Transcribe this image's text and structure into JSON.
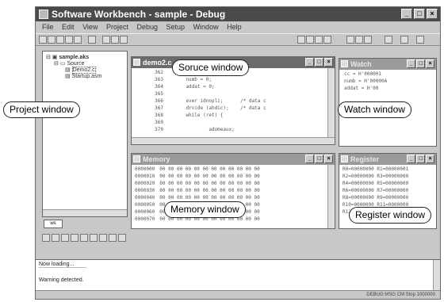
{
  "app": {
    "title": "Software Workbench - sample - Debug"
  },
  "menu": [
    "File",
    "Edit",
    "View",
    "Project",
    "Debug",
    "Setup",
    "Window",
    "Help"
  ],
  "project_window": {
    "root": "sample.aks",
    "folder": "Source",
    "files": [
      "Demo2.c",
      "Startup.asm"
    ],
    "tab": "ws"
  },
  "source_window": {
    "title": "demo2.c",
    "lines": [
      {
        "num": "362",
        "code": "{"
      },
      {
        "num": "363",
        "code": "    numb = 0;"
      },
      {
        "num": "364",
        "code": "    addat = 0;"
      },
      {
        "num": "365",
        "code": ""
      },
      {
        "num": "366",
        "code": "    ever idnopli;      /* data c"
      },
      {
        "num": "367",
        "code": "    drvide (ahdic);    /* data c"
      },
      {
        "num": "368",
        "code": "    while (ret) {"
      },
      {
        "num": "369",
        "code": ""
      },
      {
        "num": "370",
        "code": "            adomeaux;"
      }
    ]
  },
  "watch_window": {
    "title": "Watch",
    "items": [
      "cc = H'000001",
      "numb = H'00000A",
      "addat = H'00"
    ]
  },
  "memory_window": {
    "title": "Memory",
    "rows": [
      {
        "addr": "0000000",
        "hex": "00 00 00 00 00 00 00 00 00 00 00 00"
      },
      {
        "addr": "0000010",
        "hex": "00 00 00 00 00 00 00 00 00 00 00 00"
      },
      {
        "addr": "0000020",
        "hex": "00 00 00 00 00 00 00 00 00 00 00 00"
      },
      {
        "addr": "0000030",
        "hex": "00 00 00 00 00 00 00 00 00 00 00 00"
      },
      {
        "addr": "0000040",
        "hex": "00 00 00 00 00 00 00 00 00 00 00 00"
      },
      {
        "addr": "0000050",
        "hex": "00 00 00 00 00 00 00 00 00 00 00 00"
      },
      {
        "addr": "0000060",
        "hex": "00 00 00 00 00 00 00 00 00 00 00 00"
      },
      {
        "addr": "0000070",
        "hex": "00 00 00 00 00 00 00 00 00 00 00 00"
      }
    ]
  },
  "register_window": {
    "title": "Register",
    "rows": [
      "R0=00000000  R1=00000001",
      "R2=00000000  R3=00000000",
      "R4=00000000  R5=00000000",
      "R6=00000000  R7=00000000",
      "R8=00000000  R9=00000000",
      "R10=0000000  R11=0000000",
      "R12=0000000  R13=0000000"
    ]
  },
  "output_window": {
    "lines": [
      "Now loading...",
      "Warning detected."
    ]
  },
  "status": {
    "text": "DEBUG  MSG  CM  Stop  1000000"
  },
  "callouts": {
    "source": "Soruce window",
    "project": "Project window",
    "watch": "Watch window",
    "memory": "Memory window",
    "register": "Register window"
  }
}
